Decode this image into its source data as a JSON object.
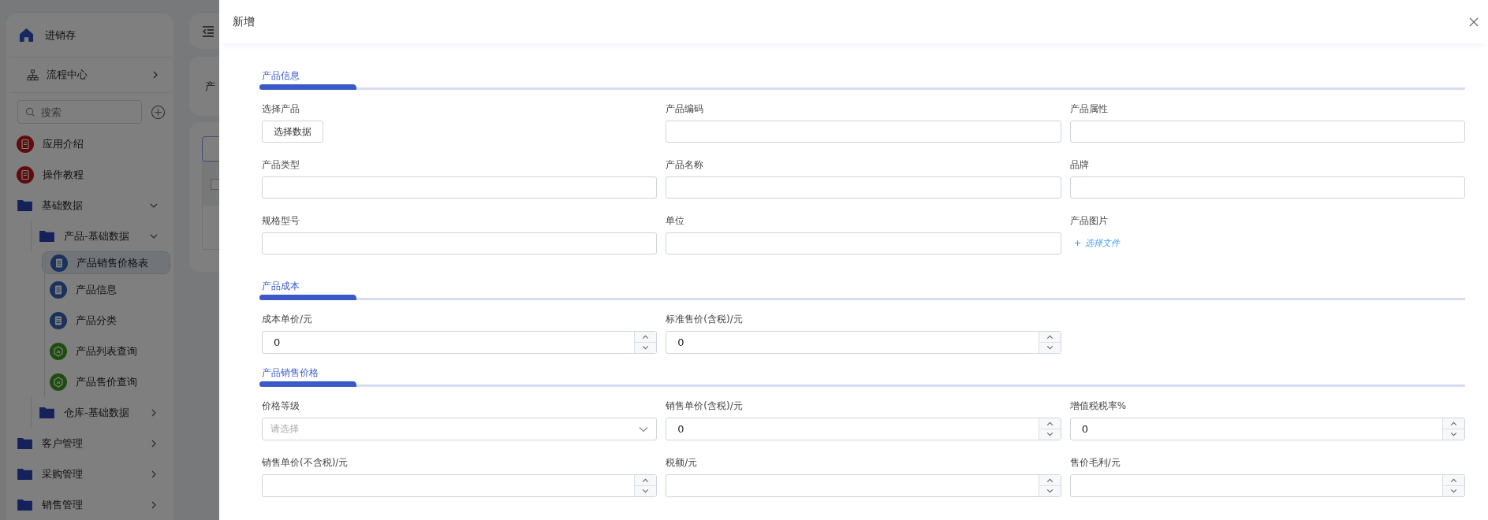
{
  "sidebar": {
    "app_title": "进销存",
    "process_center": "流程中心",
    "search": {
      "placeholder": "搜索"
    },
    "items": [
      {
        "label": "应用介绍",
        "kind": "doc",
        "selected": false
      },
      {
        "label": "操作教程",
        "kind": "doc",
        "selected": false
      },
      {
        "label": "基础数据",
        "kind": "folder",
        "selected": false,
        "expanded": true,
        "children": [
          {
            "label": "产品-基础数据",
            "kind": "folder",
            "selected": false,
            "expanded": true,
            "children": [
              {
                "label": "产品销售价格表",
                "kind": "list",
                "selected": true
              },
              {
                "label": "产品信息",
                "kind": "list",
                "selected": false
              },
              {
                "label": "产品分类",
                "kind": "list",
                "selected": false
              },
              {
                "label": "产品列表查询",
                "kind": "report",
                "selected": false
              },
              {
                "label": "产品售价查询",
                "kind": "report",
                "selected": false
              }
            ]
          },
          {
            "label": "仓库-基础数据",
            "kind": "folder",
            "selected": false,
            "expanded": false
          }
        ]
      },
      {
        "label": "客户管理",
        "kind": "folder",
        "selected": false,
        "expanded": false
      },
      {
        "label": "采购管理",
        "kind": "folder",
        "selected": false,
        "expanded": false
      },
      {
        "label": "销售管理",
        "kind": "folder",
        "selected": false,
        "expanded": false
      }
    ]
  },
  "page": {
    "title_partial": "产",
    "table": {
      "select_all_checked": false
    }
  },
  "drawer": {
    "title": "新增",
    "sections": [
      {
        "title": "产品信息",
        "fields": [
          {
            "label": "选择产品",
            "kind": "button",
            "value": "选择数据"
          },
          {
            "label": "产品编码",
            "kind": "text"
          },
          {
            "label": "产品属性",
            "kind": "text"
          },
          {
            "label": "产品类型",
            "kind": "text"
          },
          {
            "label": "产品名称",
            "kind": "text"
          },
          {
            "label": "品牌",
            "kind": "text"
          },
          {
            "label": "规格型号",
            "kind": "text"
          },
          {
            "label": "单位",
            "kind": "text"
          },
          {
            "label": "产品图片",
            "kind": "upload",
            "value": "选择文件"
          }
        ]
      },
      {
        "title": "产品成本",
        "fields": [
          {
            "label": "成本单价/元",
            "kind": "number",
            "value": "0"
          },
          {
            "label": "标准售价(含税)/元",
            "kind": "number",
            "value": "0"
          }
        ]
      },
      {
        "title": "产品销售价格",
        "fields": [
          {
            "label": "价格等级",
            "kind": "select",
            "placeholder": "请选择"
          },
          {
            "label": "销售单价(含税)/元",
            "kind": "number",
            "value": "0"
          },
          {
            "label": "增值税税率%",
            "kind": "number",
            "value": "0"
          },
          {
            "label": "销售单价(不含税)/元",
            "kind": "number"
          },
          {
            "label": "税额/元",
            "kind": "number"
          },
          {
            "label": "售价毛利/元",
            "kind": "number"
          }
        ]
      }
    ]
  }
}
